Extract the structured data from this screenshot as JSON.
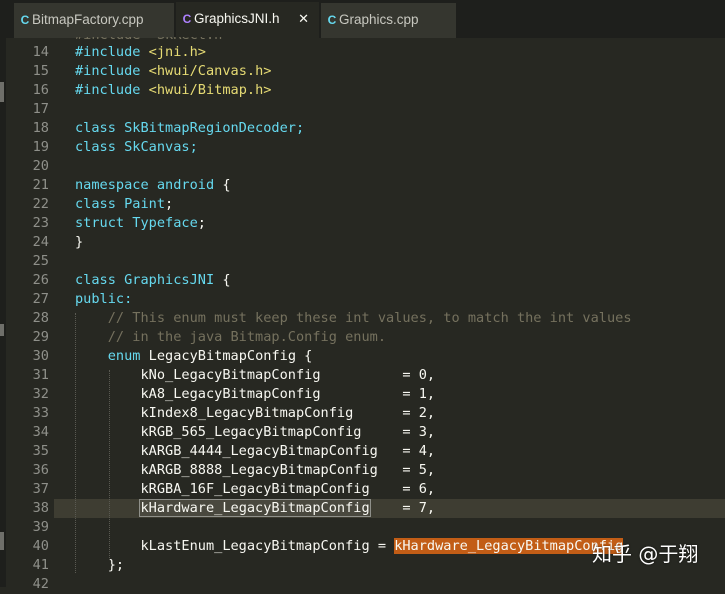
{
  "tabs": [
    {
      "icon": "C",
      "label": "BitmapFactory.cpp",
      "active": false
    },
    {
      "icon": "C",
      "label": "GraphicsJNI.h",
      "active": true,
      "close": "✕"
    },
    {
      "icon": "C",
      "label": "Graphics.cpp",
      "active": false
    }
  ],
  "colors": {
    "background": "#272822",
    "keyword": "#66d9ef",
    "string": "#e6db74",
    "comment": "#75715e",
    "type": "#a6e22e",
    "match_highlight": "#c25d16"
  },
  "editor": {
    "top_partial_line": "#include \"SkRect.h\"",
    "lines": [
      {
        "n": "14",
        "segs": [
          {
            "t": "#include ",
            "c": "kw"
          },
          {
            "t": "<jni.h>",
            "c": "str"
          }
        ]
      },
      {
        "n": "15",
        "segs": [
          {
            "t": "#include ",
            "c": "kw"
          },
          {
            "t": "<hwui/Canvas.h>",
            "c": "str"
          }
        ]
      },
      {
        "n": "16",
        "segs": [
          {
            "t": "#include ",
            "c": "kw"
          },
          {
            "t": "<hwui/Bitmap.h>",
            "c": "str"
          }
        ]
      },
      {
        "n": "17",
        "segs": []
      },
      {
        "n": "18",
        "segs": [
          {
            "t": "class ",
            "c": "kw"
          },
          {
            "t": "SkBitmapRegionDecoder;",
            "c": "kw"
          }
        ]
      },
      {
        "n": "19",
        "segs": [
          {
            "t": "class ",
            "c": "kw"
          },
          {
            "t": "SkCanvas;",
            "c": "kw"
          }
        ]
      },
      {
        "n": "20",
        "segs": []
      },
      {
        "n": "21",
        "segs": [
          {
            "t": "namespace ",
            "c": "kw"
          },
          {
            "t": "android",
            "c": "kw"
          },
          {
            "t": " {",
            "c": "op"
          }
        ]
      },
      {
        "n": "22",
        "segs": [
          {
            "t": "class ",
            "c": "kw"
          },
          {
            "t": "Paint",
            "c": "kw"
          },
          {
            "t": ";",
            "c": "op"
          }
        ]
      },
      {
        "n": "23",
        "segs": [
          {
            "t": "struct ",
            "c": "kw"
          },
          {
            "t": "Typeface",
            "c": "kw"
          },
          {
            "t": ";",
            "c": "op"
          }
        ]
      },
      {
        "n": "24",
        "segs": [
          {
            "t": "}",
            "c": "op"
          }
        ]
      },
      {
        "n": "25",
        "segs": []
      },
      {
        "n": "26",
        "segs": [
          {
            "t": "class ",
            "c": "kw"
          },
          {
            "t": "GraphicsJNI",
            "c": "kw"
          },
          {
            "t": " {",
            "c": "op"
          }
        ]
      },
      {
        "n": "27",
        "segs": [
          {
            "t": "public:",
            "c": "kw"
          }
        ]
      },
      {
        "n": "28",
        "segs": [
          {
            "t": "    // This enum must keep these int values, to match the int values",
            "c": "cm"
          }
        ]
      },
      {
        "n": "29",
        "segs": [
          {
            "t": "    // in the java Bitmap.Config enum.",
            "c": "cm"
          }
        ]
      },
      {
        "n": "30",
        "segs": [
          {
            "t": "    ",
            "c": "op"
          },
          {
            "t": "enum",
            "c": "kw"
          },
          {
            "t": " LegacyBitmapConfig {",
            "c": "op"
          }
        ]
      },
      {
        "n": "31",
        "segs": [
          {
            "t": "        kNo_LegacyBitmapConfig          = 0,",
            "c": "op"
          }
        ]
      },
      {
        "n": "32",
        "segs": [
          {
            "t": "        kA8_LegacyBitmapConfig          = 1,",
            "c": "op"
          }
        ]
      },
      {
        "n": "33",
        "segs": [
          {
            "t": "        kIndex8_LegacyBitmapConfig      = 2,",
            "c": "op"
          }
        ]
      },
      {
        "n": "34",
        "segs": [
          {
            "t": "        kRGB_565_LegacyBitmapConfig     = 3,",
            "c": "op"
          }
        ]
      },
      {
        "n": "35",
        "segs": [
          {
            "t": "        kARGB_4444_LegacyBitmapConfig   = 4,",
            "c": "op"
          }
        ]
      },
      {
        "n": "36",
        "segs": [
          {
            "t": "        kARGB_8888_LegacyBitmapConfig   = 5,",
            "c": "op"
          }
        ]
      },
      {
        "n": "37",
        "segs": [
          {
            "t": "        kRGBA_16F_LegacyBitmapConfig    = 6,",
            "c": "op"
          }
        ]
      },
      {
        "n": "38",
        "current": true,
        "segs": [
          {
            "t": "        ",
            "c": "op"
          },
          {
            "t": "kHardware_LegacyBitmapConfig",
            "c": "sel"
          },
          {
            "t": "    = 7,",
            "c": "op"
          }
        ]
      },
      {
        "n": "39",
        "segs": []
      },
      {
        "n": "40",
        "segs": [
          {
            "t": "        kLastEnum_LegacyBitmapConfig = ",
            "c": "op"
          },
          {
            "t": "kHardware_LegacyBitmapConfig",
            "c": "match"
          }
        ]
      },
      {
        "n": "41",
        "segs": [
          {
            "t": "    };",
            "c": "op"
          }
        ]
      },
      {
        "n": "42",
        "segs": []
      }
    ]
  },
  "watermark": "知乎 @于翔"
}
